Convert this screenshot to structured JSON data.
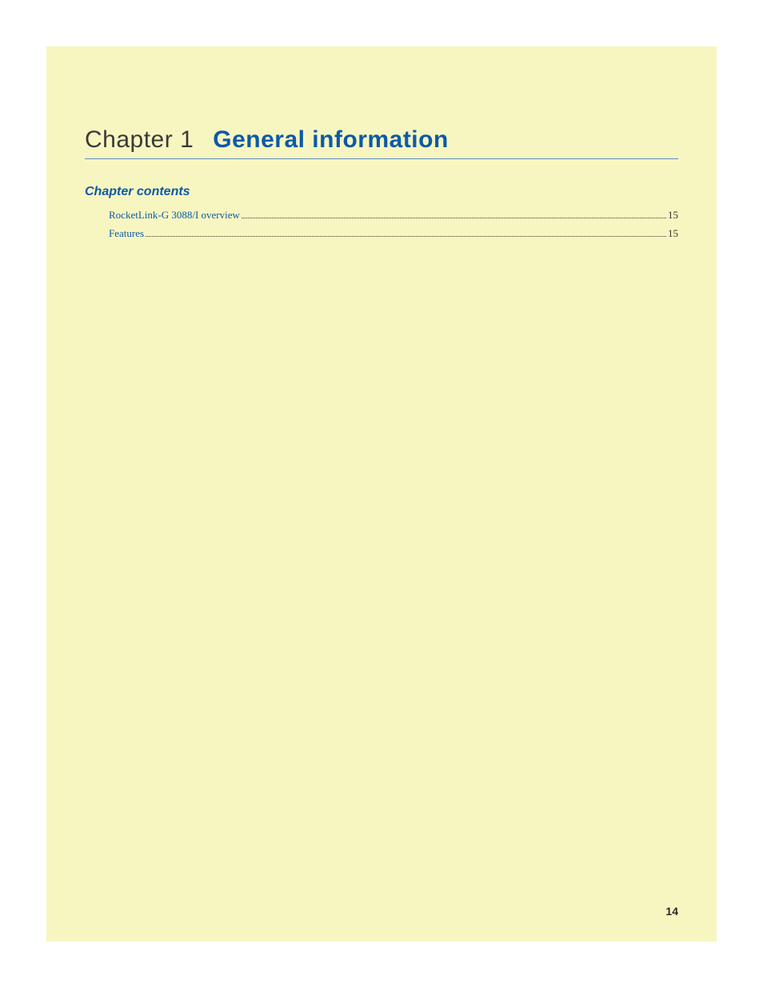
{
  "chapter": {
    "label": "Chapter 1",
    "title": "General information"
  },
  "contents": {
    "heading": "Chapter contents",
    "entries": [
      {
        "text": "RocketLink-G 3088/I overview",
        "page": "15"
      },
      {
        "text": "Features",
        "page": "15"
      }
    ]
  },
  "pageNumber": "14"
}
